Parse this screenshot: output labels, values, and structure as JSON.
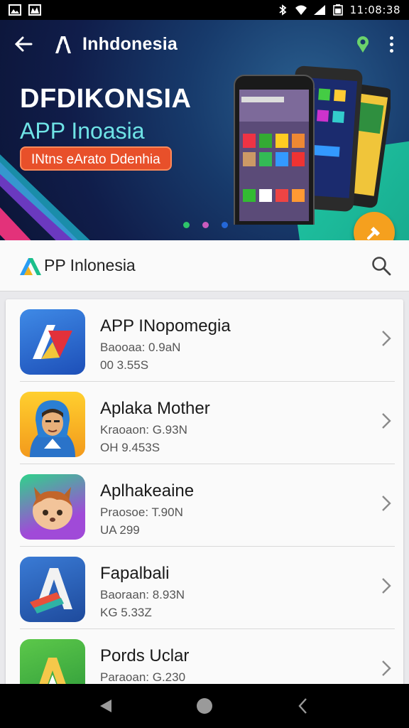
{
  "status_bar": {
    "time": "11:08:38",
    "left_icons": [
      "image-icon",
      "gallery-icon"
    ],
    "right_icons": [
      "bluetooth-icon",
      "wifi-icon",
      "signal-icon",
      "battery-icon"
    ]
  },
  "hero": {
    "brand": "Inhdonesia",
    "title": "DFDIKONSIA",
    "subtitle": "APP Inoasia",
    "pill_text": "INtns eArato Ddenhia",
    "carousel_dots": [
      "#2ec46a",
      "#c95bbd",
      "#2467d8"
    ],
    "fab_icon": "hammer-icon",
    "colors": {
      "pill": "#e8502a",
      "subtitle": "#6fe3e6",
      "fab": "#f5a01e",
      "teal": "#1fc7a4"
    }
  },
  "search_header": {
    "title": "PP Inlonesia",
    "search_icon": "search-icon"
  },
  "apps": [
    {
      "name": "APP INopomegia",
      "meta1": "Baooaa: 0.9aN",
      "meta2": "00 3.55S",
      "icon": "app-a-red-icon"
    },
    {
      "name": "Aplaka Mother",
      "meta1": "Kraoaon: G.93N",
      "meta2": "OH 9.453S",
      "icon": "hooded-man-icon"
    },
    {
      "name": "Aplhakeaine",
      "meta1": "Praosoe: T.90N",
      "meta2": "UA 299",
      "icon": "fox-face-icon"
    },
    {
      "name": "Fapalbali",
      "meta1": "Baoraan: 8.93N",
      "meta2": "KG 5.33Z",
      "icon": "app-a-orange-icon"
    },
    {
      "name": "Pords Uclar",
      "meta1": "Paraoan: G.230",
      "meta2": "",
      "icon": "app-a-green-icon"
    }
  ],
  "nav": {
    "back": "back-triangle-icon",
    "home": "home-circle-icon",
    "recents": "recents-icon"
  }
}
